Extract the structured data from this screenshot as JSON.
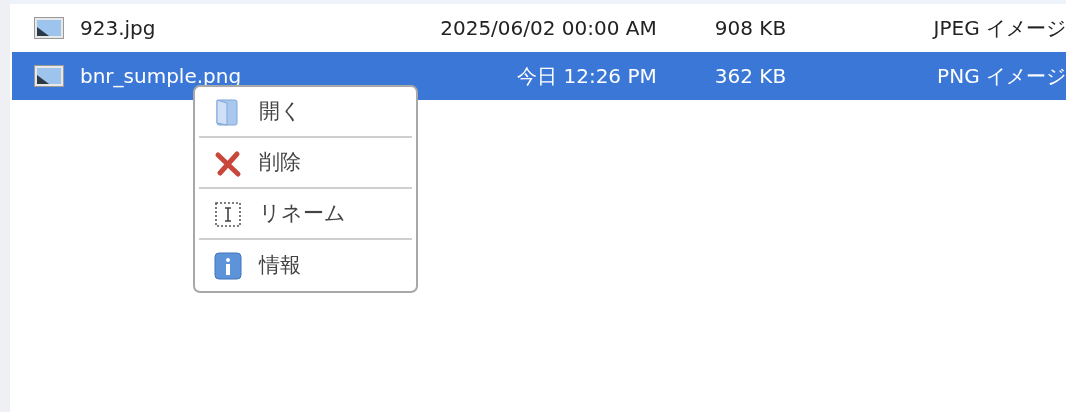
{
  "files": [
    {
      "name": "923.jpg",
      "modified": "2025/06/02 00:00 AM",
      "size": "908 KB",
      "type": "JPEG イメージ",
      "selected": false
    },
    {
      "name": "bnr_sumple.png",
      "modified": "今日 12:26 PM",
      "size": "362 KB",
      "type": "PNG イメージ",
      "selected": true
    }
  ],
  "context_menu": {
    "items": [
      {
        "kind": "open",
        "label": "開く"
      },
      {
        "kind": "delete",
        "label": "削除"
      },
      {
        "kind": "rename",
        "label": "リネーム"
      },
      {
        "kind": "info",
        "label": "情報"
      }
    ]
  }
}
